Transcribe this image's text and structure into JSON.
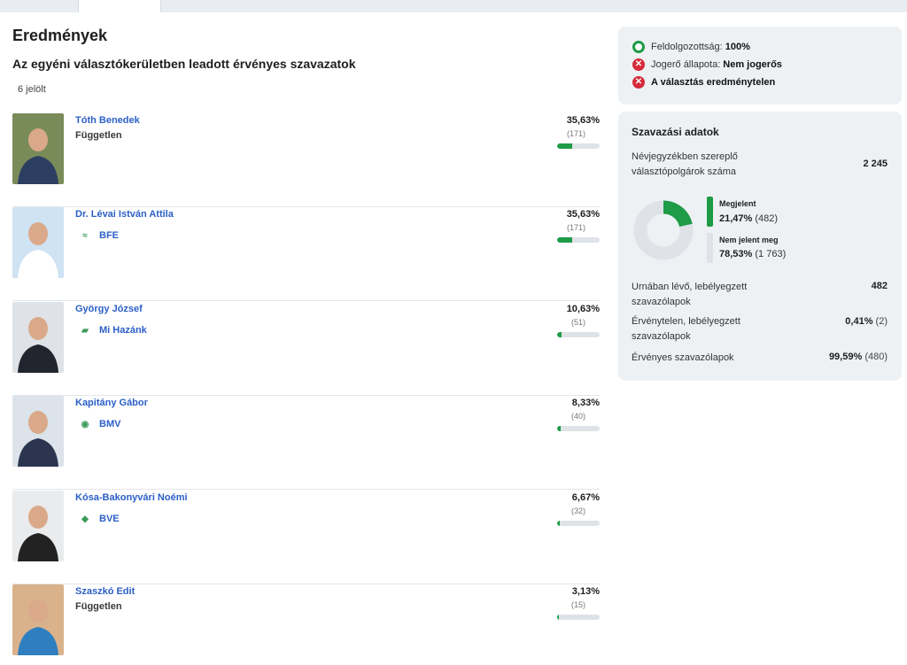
{
  "page": {
    "title": "Eredmények",
    "subtitle": "Az egyéni választókerületben leadott érvényes szavazatok",
    "candidate_count": "6 jelölt"
  },
  "candidates": [
    {
      "name": "Tóth Benedek",
      "party": "Független",
      "party_logo": false,
      "pct": "35,63%",
      "votes": "(171)",
      "share": 35.63,
      "photo_icon": "person-photo"
    },
    {
      "name": "Dr. Lévai István Attila",
      "party": "BFE",
      "party_logo": true,
      "pct": "35,63%",
      "votes": "(171)",
      "share": 35.63,
      "photo_icon": "person-photo"
    },
    {
      "name": "György József",
      "party": "Mi Hazánk",
      "party_logo": true,
      "pct": "10,63%",
      "votes": "(51)",
      "share": 10.63,
      "photo_icon": "person-photo"
    },
    {
      "name": "Kapitány Gábor",
      "party": "BMV",
      "party_logo": true,
      "pct": "8,33%",
      "votes": "(40)",
      "share": 8.33,
      "photo_icon": "person-photo"
    },
    {
      "name": "Kósa-Bakonyvári Noémi",
      "party": "BVE",
      "party_logo": true,
      "pct": "6,67%",
      "votes": "(32)",
      "share": 6.67,
      "photo_icon": "person-photo"
    },
    {
      "name": "Szaszkó Edit",
      "party": "Független",
      "party_logo": false,
      "pct": "3,13%",
      "votes": "(15)",
      "share": 3.13,
      "photo_icon": "person-photo"
    }
  ],
  "status": {
    "processed_label": "Feldolgozottság:",
    "processed_value": "100%",
    "final_label": "Jogerő állapota:",
    "final_value": "Nem jogerős",
    "invalid_text": "A választás eredménytelen"
  },
  "voting": {
    "title": "Szavazási adatok",
    "registered_label": "Névjegyzékben szereplő választópolgárok száma",
    "registered_value": "2 245",
    "turnout_label": "Megjelent",
    "turnout_pct": "21,47%",
    "turnout_count": "(482)",
    "turnout_share": 21.47,
    "absent_label": "Nem jelent meg",
    "absent_pct": "78,53%",
    "absent_count": "(1 763)",
    "ballots_label": "Urnában lévő, lebélyegzett szavazólapok",
    "ballots_value": "482",
    "invalid_label": "Érvénytelen, lebélyegzett szavazólapok",
    "invalid_pct": "0,41%",
    "invalid_count": "(2)",
    "valid_label": "Érvényes szavazólapok",
    "valid_pct": "99,59%",
    "valid_count": "(480)"
  },
  "colors": {
    "green": "#1e9b46",
    "link": "#2b5fc7",
    "red": "#d62b3b",
    "gray_bar": "#dfe3e8"
  }
}
